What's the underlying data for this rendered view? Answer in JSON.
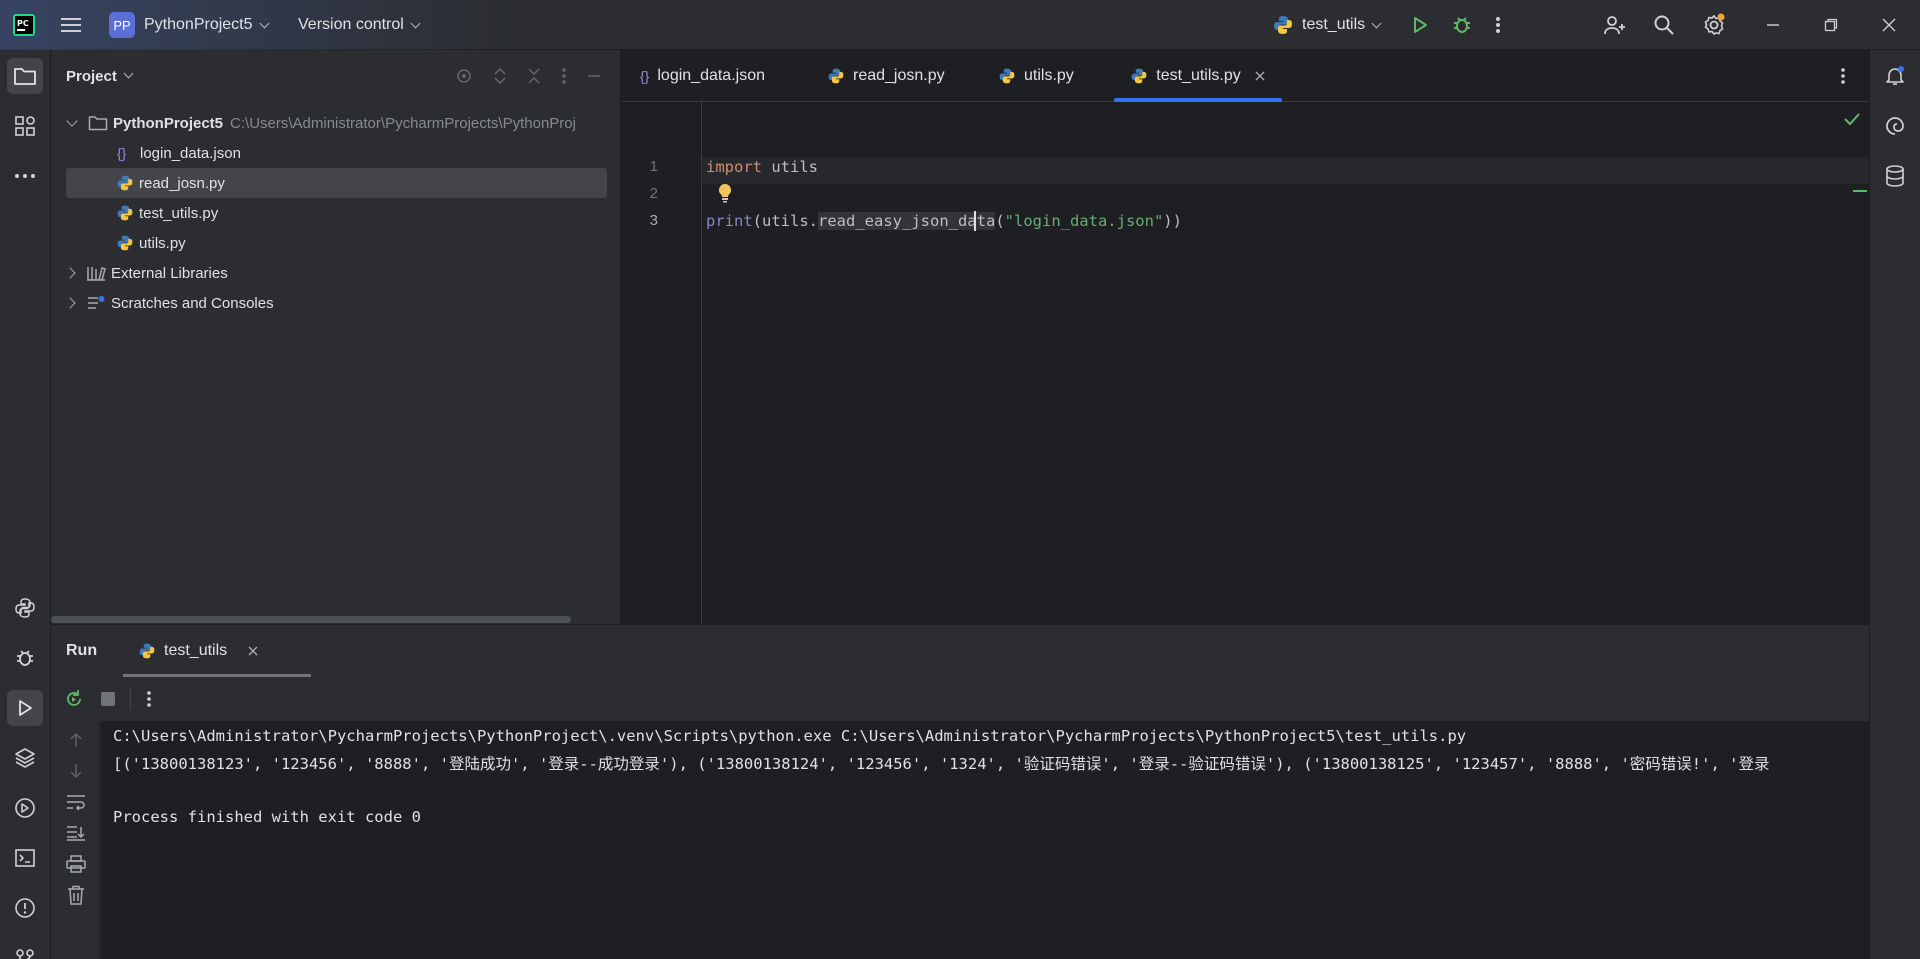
{
  "titlebar": {
    "project_badge": "PP",
    "project_name": "PythonProject5",
    "vcs": "Version control",
    "run_config": "test_utils"
  },
  "project_panel": {
    "title": "Project",
    "tree": [
      {
        "label": "PythonProject5",
        "path": "C:\\Users\\Administrator\\PycharmProjects\\PythonProj",
        "kind": "folder"
      },
      {
        "label": "login_data.json",
        "kind": "json"
      },
      {
        "label": "read_josn.py",
        "kind": "python",
        "selected": true
      },
      {
        "label": "test_utils.py",
        "kind": "python"
      },
      {
        "label": "utils.py",
        "kind": "python"
      },
      {
        "label": "External Libraries",
        "kind": "library"
      },
      {
        "label": "Scratches and Consoles",
        "kind": "scratch"
      }
    ]
  },
  "editor": {
    "tabs": [
      {
        "label": "login_data.json",
        "kind": "json"
      },
      {
        "label": "read_josn.py",
        "kind": "python"
      },
      {
        "label": "utils.py",
        "kind": "python"
      },
      {
        "label": "test_utils.py",
        "kind": "python",
        "active": true
      }
    ],
    "line_numbers": [
      "1",
      "2",
      "3"
    ],
    "code": {
      "line1_kw": "import",
      "line1_rest": " utils",
      "line3_fn": "print",
      "line3_a": "(utils.",
      "line3_b": "read_easy_json_data",
      "line3_c": "(",
      "line3_str": "\"login_data.json\"",
      "line3_d": "))"
    }
  },
  "run_panel": {
    "title": "Run",
    "tab": "test_utils",
    "console": [
      "C:\\Users\\Administrator\\PycharmProjects\\PythonProject\\.venv\\Scripts\\python.exe C:\\Users\\Administrator\\PycharmProjects\\PythonProject5\\test_utils.py",
      "[('13800138123', '123456', '8888', '登陆成功', '登录--成功登录'), ('13800138124', '123456', '1324', '验证码错误', '登录--验证码错误'), ('13800138125', '123457', '8888', '密码错误!', '登录",
      "",
      "Process finished with exit code 0"
    ]
  },
  "colors": {
    "accent": "#3574f0",
    "run_green": "#5fb865",
    "bg_editor": "#1e1f22",
    "bg_panel": "#2b2d30"
  }
}
